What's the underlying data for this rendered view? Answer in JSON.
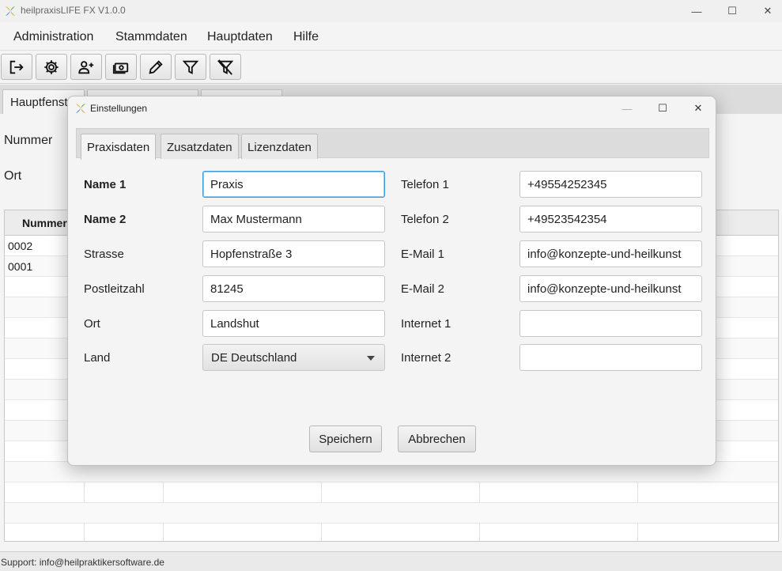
{
  "window": {
    "title": "heilpraxisLIFE FX V1.0.0",
    "minimize_glyph": "—",
    "maximize_glyph": "☐",
    "close_glyph": "✕"
  },
  "menubar": {
    "items": [
      "Administration",
      "Stammdaten",
      "Hauptdaten",
      "Hilfe"
    ]
  },
  "toolbar": {
    "icons": [
      "logout-icon",
      "gear-icon",
      "add-user-icon",
      "money-icon",
      "pencil-icon",
      "filter-icon",
      "clear-filter-icon"
    ]
  },
  "main": {
    "tabs": [
      "Hauptfenster",
      "",
      ""
    ],
    "labels": {
      "nummer": "Nummer",
      "ort": "Ort"
    },
    "grid": {
      "header": "Nummer",
      "rows": [
        "0002",
        "0001"
      ]
    }
  },
  "status": {
    "text": "Support: info@heilpraktikersoftware.de"
  },
  "dialog": {
    "title": "Einstellungen",
    "minimize_glyph": "—",
    "maximize_glyph": "☐",
    "close_glyph": "✕",
    "tabs": [
      "Praxisdaten",
      "Zusatzdaten",
      "Lizenzdaten"
    ],
    "active_tab": "Praxisdaten",
    "left": {
      "name1": {
        "label": "Name 1",
        "value": "Praxis"
      },
      "name2": {
        "label": "Name 2",
        "value": "Max Mustermann"
      },
      "strasse": {
        "label": "Strasse",
        "value": "Hopfenstraße 3"
      },
      "plz": {
        "label": "Postleitzahl",
        "value": "81245"
      },
      "ort": {
        "label": "Ort",
        "value": "Landshut"
      },
      "land": {
        "label": "Land",
        "value": "DE Deutschland"
      }
    },
    "right": {
      "telefon1": {
        "label": "Telefon 1",
        "value": "+49554252345"
      },
      "telefon2": {
        "label": "Telefon 2",
        "value": "+49523542354"
      },
      "email1": {
        "label": "E-Mail 1",
        "value": "info@konzepte-und-heilkunst"
      },
      "email2": {
        "label": "E-Mail 2",
        "value": "info@konzepte-und-heilkunst"
      },
      "internet1": {
        "label": "Internet 1",
        "value": ""
      },
      "internet2": {
        "label": "Internet 2",
        "value": ""
      }
    },
    "buttons": {
      "save": "Speichern",
      "cancel": "Abbrechen"
    },
    "colors": {
      "focus": "#3e9bd8"
    }
  }
}
